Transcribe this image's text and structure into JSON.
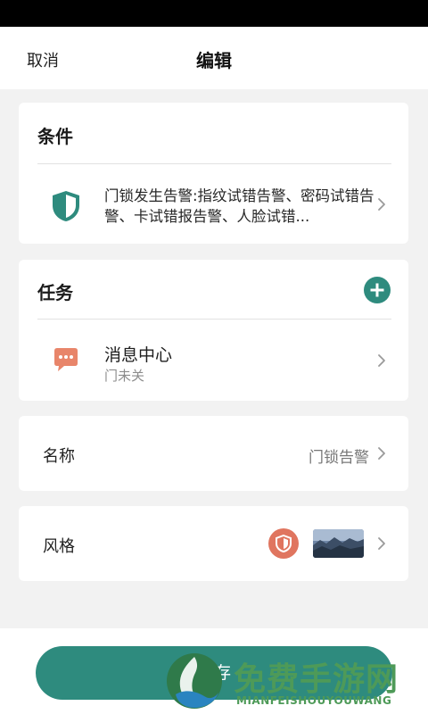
{
  "nav": {
    "cancel_label": "取消",
    "title": "编辑"
  },
  "condition": {
    "section_title": "条件",
    "icon": "shield-icon",
    "description": "门锁发生告警:指纹试错告警、密码试错告警、卡试错报告警、人脸试错..."
  },
  "task": {
    "section_title": "任务",
    "add_icon": "plus-circle-icon",
    "item": {
      "icon": "chat-bubble-icon",
      "name": "消息中心",
      "subtitle": "门未关"
    }
  },
  "name_row": {
    "label": "名称",
    "value": "门锁告警"
  },
  "style_row": {
    "label": "风格",
    "icon": "shield-icon",
    "thumbnail": "landscape-thumbnail"
  },
  "save": {
    "label": "保存"
  },
  "watermark": {
    "text_cn": "免费手游网",
    "text_en": "MIANFEISHOUYOUWANG"
  },
  "colors": {
    "accent": "#2e8b7e",
    "alert": "#e0755f",
    "background": "#f2f2f2"
  }
}
